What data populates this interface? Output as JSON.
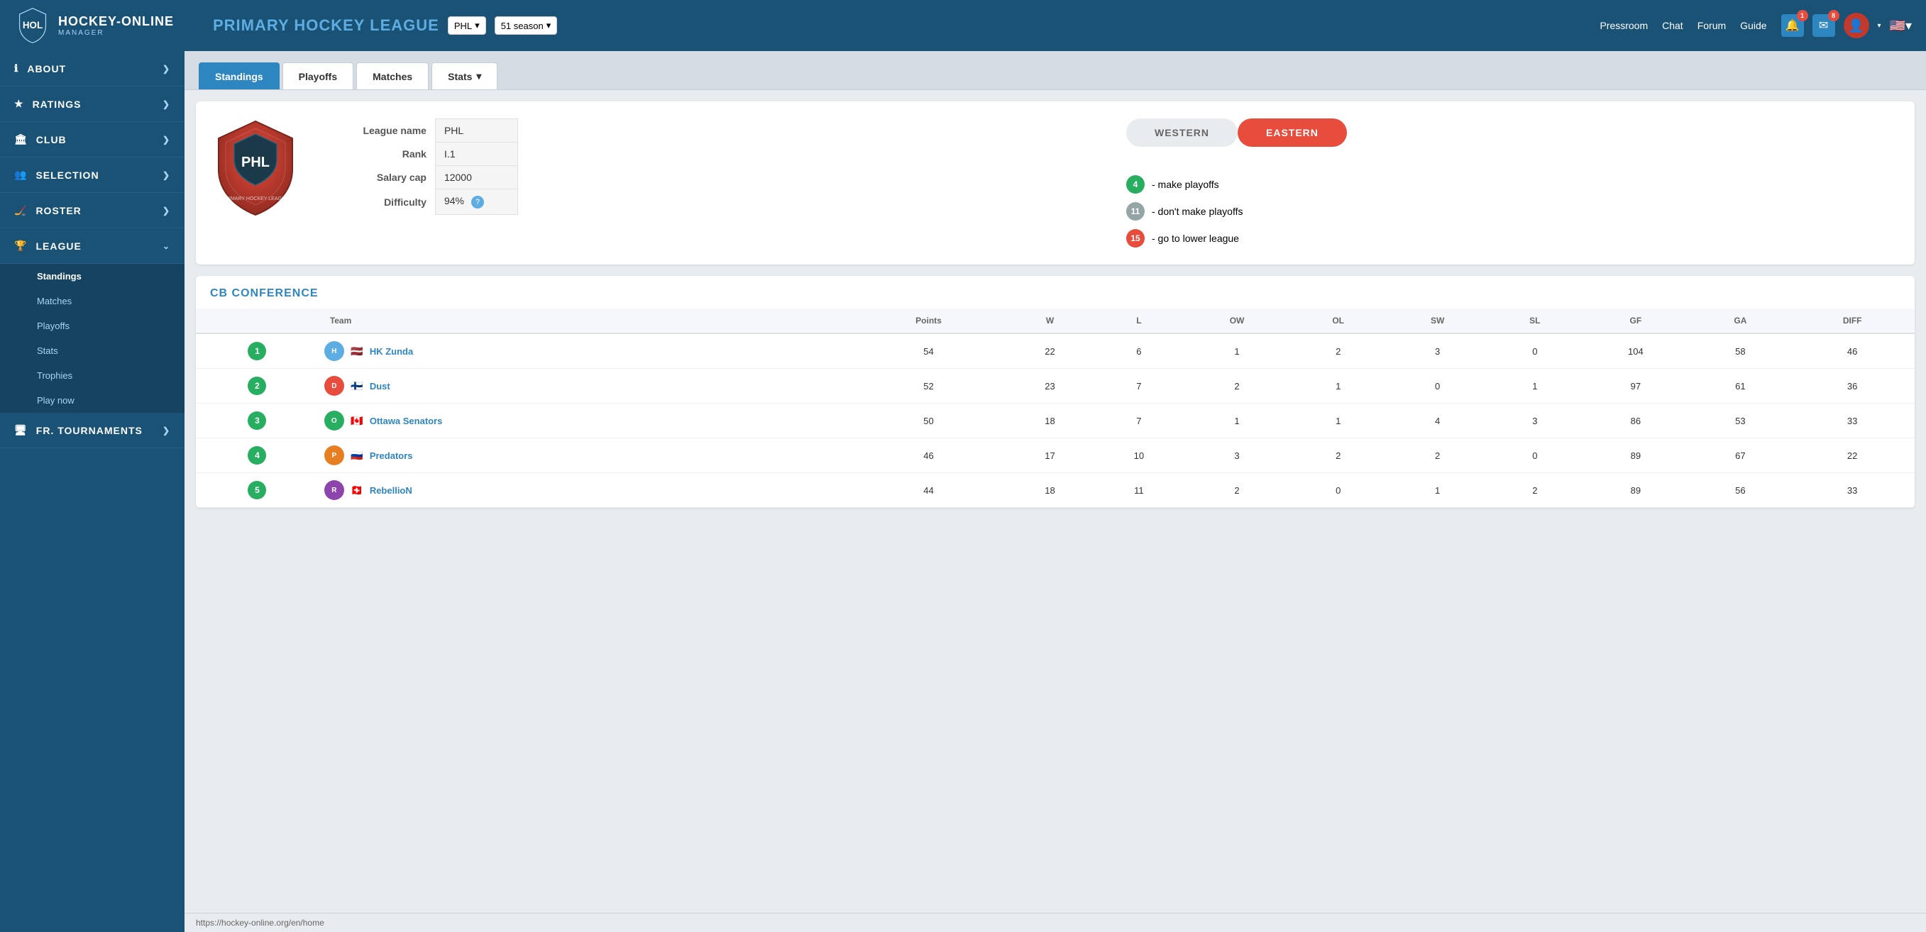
{
  "app": {
    "title": "HOCKEY-ONLINE MANAGER",
    "title_line1": "HOCKEY-ONLINE",
    "title_line2": "MANAGER"
  },
  "topbar": {
    "league_title": "PRIMARY HOCKEY LEAGUE",
    "league_selector": "PHL",
    "season_selector": "51 season",
    "nav": [
      "Pressroom",
      "Chat",
      "Forum",
      "Guide"
    ],
    "notifications_1": "1",
    "notifications_2": "8"
  },
  "sidebar": {
    "items": [
      {
        "label": "ABOUT",
        "icon": "ℹ",
        "expandable": true
      },
      {
        "label": "RATINGS",
        "icon": "★",
        "expandable": true
      },
      {
        "label": "CLUB",
        "icon": "🏛",
        "expandable": true
      },
      {
        "label": "SELECTION",
        "icon": "👥",
        "expandable": true
      },
      {
        "label": "ROSTER",
        "icon": "🏒",
        "expandable": true
      },
      {
        "label": "LEAGUE",
        "icon": "🏆",
        "expandable": true,
        "active": true
      }
    ],
    "league_subitems": [
      "Standings",
      "Matches",
      "Playoffs",
      "Stats",
      "Trophies",
      "Play now"
    ],
    "fr_tournaments": {
      "label": "FR. TOURNAMENTS",
      "icon": "🖥",
      "expandable": true
    }
  },
  "tabs": [
    "Standings",
    "Playoffs",
    "Matches",
    "Stats"
  ],
  "league_info": {
    "league_name_label": "League name",
    "league_name_value": "PHL",
    "rank_label": "Rank",
    "rank_value": "I.1",
    "salary_cap_label": "Salary cap",
    "salary_cap_value": "12000",
    "difficulty_label": "Difficulty",
    "difficulty_value": "94%"
  },
  "conferences": {
    "western": "WESTERN",
    "eastern": "EASTERN",
    "active": "eastern"
  },
  "playoff_info": [
    {
      "badge": "4",
      "color": "green",
      "text": "- make playoffs"
    },
    {
      "badge": "11",
      "color": "gray",
      "text": "- don't make playoffs"
    },
    {
      "badge": "15",
      "color": "red",
      "text": "- go to lower league"
    }
  ],
  "conference_title": "CB CONFERENCE",
  "table": {
    "headers": [
      "",
      "Team",
      "Points",
      "W",
      "L",
      "OW",
      "OL",
      "SW",
      "SL",
      "GF",
      "GA",
      "DIFF"
    ],
    "rows": [
      {
        "rank": 1,
        "team": "HK Zunda",
        "flag": "🇱🇻",
        "points": 54,
        "w": 22,
        "l": 6,
        "ow": 1,
        "ol": 2,
        "sw": 3,
        "sl": 0,
        "gf": 104,
        "ga": 58,
        "diff": 46
      },
      {
        "rank": 2,
        "team": "Dust",
        "flag": "🇫🇮",
        "points": 52,
        "w": 23,
        "l": 7,
        "ow": 2,
        "ol": 1,
        "sw": 0,
        "sl": 1,
        "gf": 97,
        "ga": 61,
        "diff": 36
      },
      {
        "rank": 3,
        "team": "Ottawa Senators",
        "flag": "🇨🇦",
        "points": 50,
        "w": 18,
        "l": 7,
        "ow": 1,
        "ol": 1,
        "sw": 4,
        "sl": 3,
        "gf": 86,
        "ga": 53,
        "diff": 33
      },
      {
        "rank": 4,
        "team": "Predators",
        "flag": "🇷🇺",
        "points": 46,
        "w": 17,
        "l": 10,
        "ow": 3,
        "ol": 2,
        "sw": 2,
        "sl": 0,
        "gf": 89,
        "ga": 67,
        "diff": 22
      },
      {
        "rank": 5,
        "team": "RebellioN",
        "flag": "🇨🇭",
        "points": 44,
        "w": 18,
        "l": 11,
        "ow": 2,
        "ol": 0,
        "sw": 1,
        "sl": 2,
        "gf": 89,
        "ga": 56,
        "diff": 33
      }
    ]
  },
  "status_bar": {
    "url": "https://hockey-online.org/en/home"
  }
}
